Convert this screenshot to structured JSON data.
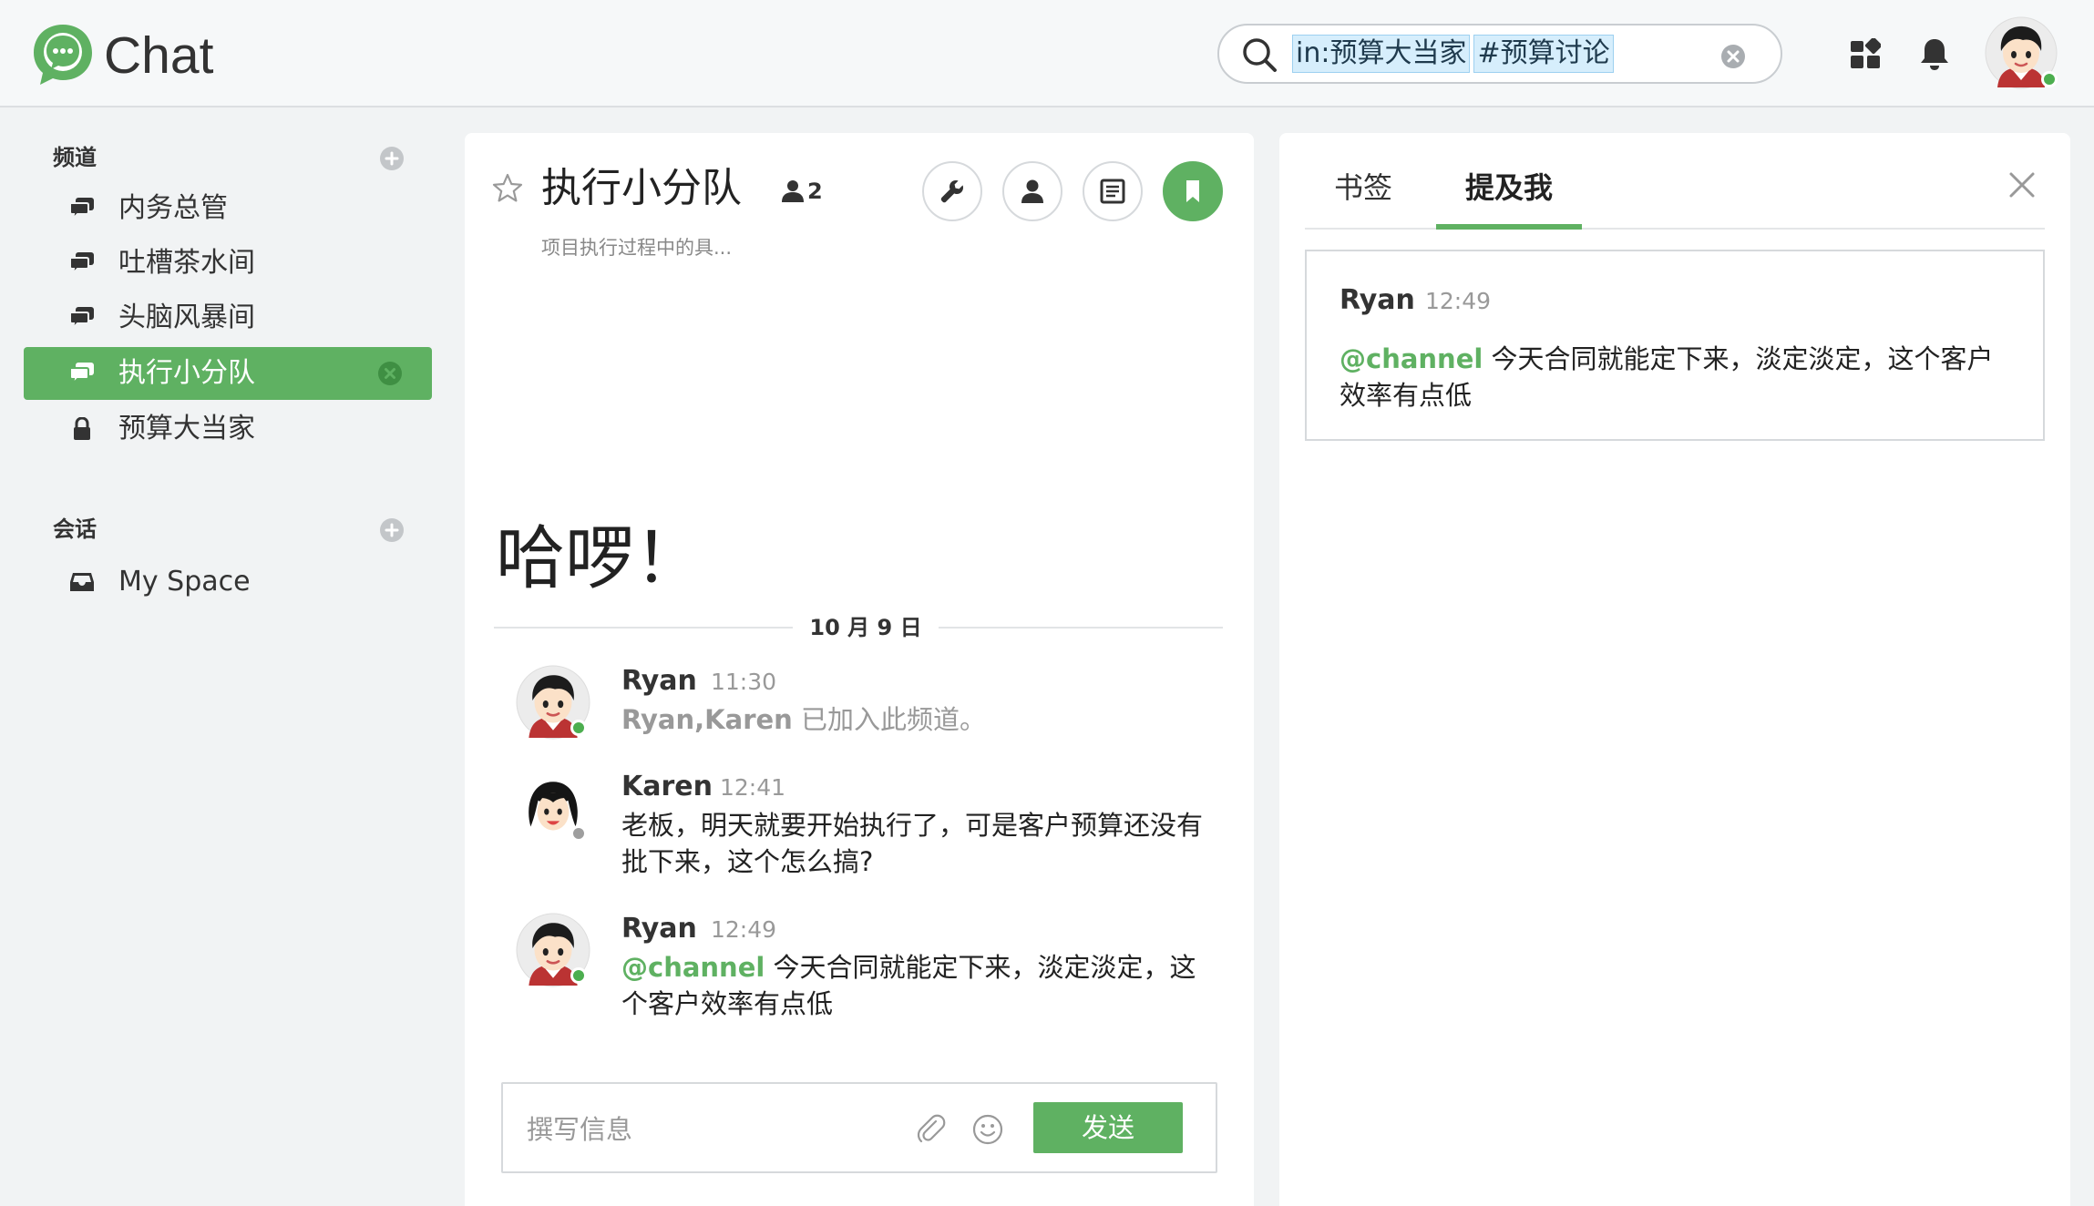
{
  "header": {
    "app_title": "Chat",
    "search": {
      "token1": "in:预算大当家",
      "token2": "#预算讨论"
    }
  },
  "sidebar": {
    "channels_title": "频道",
    "channels": [
      {
        "label": "内务总管",
        "icon": "chat-bubbles-icon"
      },
      {
        "label": "吐槽茶水间",
        "icon": "chat-bubbles-icon"
      },
      {
        "label": "头脑风暴间",
        "icon": "chat-bubbles-icon"
      },
      {
        "label": "执行小分队",
        "icon": "chat-bubbles-icon",
        "active": true
      },
      {
        "label": "预算大当家",
        "icon": "lock-icon"
      }
    ],
    "conversations_title": "会话",
    "conversations": [
      {
        "label": "My Space",
        "icon": "inbox-icon"
      }
    ]
  },
  "channel": {
    "title": "执行小分队",
    "member_count": "2",
    "subtitle": "项目执行过程中的具...",
    "hello": "哈啰！",
    "date_label": "10 月 9 日",
    "messages": [
      {
        "author": "Ryan",
        "time": "11:30",
        "names": "Ryan,Karen",
        "text": " 已加入此频道。"
      },
      {
        "author": "Karen",
        "time": "12:41",
        "text": "老板，明天就要开始执行了，可是客户预算还没有批下来，这个怎么搞?"
      },
      {
        "author": "Ryan",
        "time": "12:49",
        "mention": "@channel",
        "text": " 今天合同就能定下来，淡定淡定，这个客户效率有点低"
      }
    ],
    "composer": {
      "placeholder": "撰写信息",
      "send_label": "发送"
    }
  },
  "right_panel": {
    "tabs": [
      "书签",
      "提及我"
    ],
    "active_tab": "提及我",
    "mention": {
      "author": "Ryan",
      "time": "12:49",
      "mention": "@channel",
      "text": " 今天合同就能定下来，淡定淡定，这个客户效率有点低"
    }
  },
  "colors": {
    "accent": "#5fb162",
    "online": "#4cae4f",
    "offline": "#9e9e9e"
  }
}
